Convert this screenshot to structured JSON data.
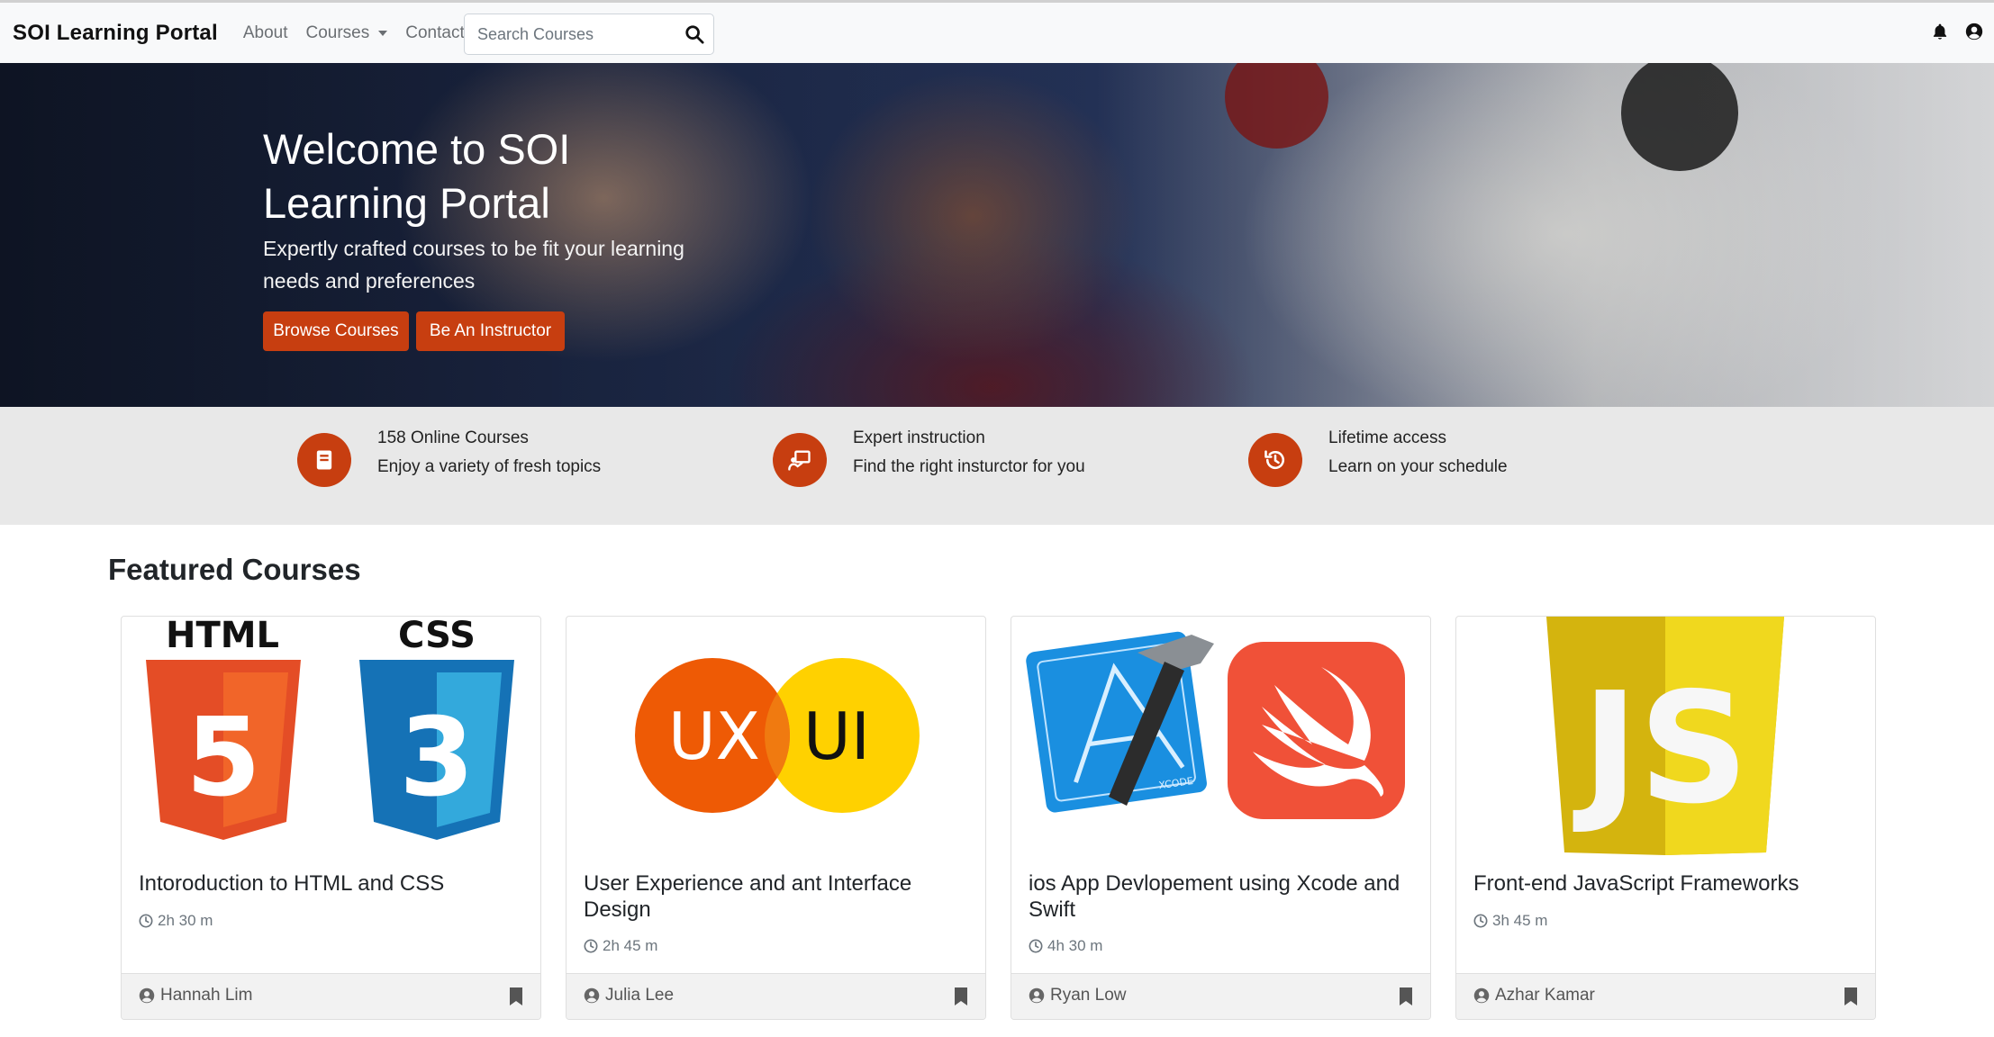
{
  "navbar": {
    "brand": "SOI Learning Portal",
    "links": [
      {
        "label": "About"
      },
      {
        "label": "Courses"
      },
      {
        "label": "Contact"
      }
    ],
    "search_placeholder": "Search Courses"
  },
  "hero": {
    "title": "Welcome to SOI Learning Portal",
    "subtitle": "Expertly crafted courses to be fit your learning needs and preferences",
    "browse_label": "Browse Courses",
    "instructor_label": "Be An Instructor"
  },
  "features": [
    {
      "icon": "book-icon",
      "title": "158 Online Courses",
      "subtitle": "Enjoy a variety of fresh topics"
    },
    {
      "icon": "instructor-icon",
      "title": "Expert instruction",
      "subtitle": "Find the right insturctor for you"
    },
    {
      "icon": "history-icon",
      "title": "Lifetime access",
      "subtitle": "Learn on your schedule"
    }
  ],
  "featured": {
    "title": "Featured Courses",
    "courses": [
      {
        "title": "Intoroduction to HTML and CSS",
        "duration": "2h 30 m",
        "author": "Hannah Lim"
      },
      {
        "title": "User Experience and ant Interface Design",
        "duration": "2h 45 m",
        "author": "Julia Lee"
      },
      {
        "title": "ios App Devlopement using Xcode and Swift",
        "duration": "4h 30 m",
        "author": "Ryan Low"
      },
      {
        "title": "Front-end JavaScript Frameworks",
        "duration": "3h 45 m",
        "author": "Azhar Kamar"
      }
    ],
    "logos": {
      "html_text": "HTML",
      "css_text": "CSS",
      "html_digit": "5",
      "css_digit": "3",
      "ux_text": "UX",
      "ui_text": "UI",
      "js_text": "JS",
      "xcode_text": "XCODE"
    }
  },
  "colors": {
    "accent": "#c73e10",
    "navbar_bg": "#f8f9fa",
    "strip_bg": "#e8e8e8"
  }
}
